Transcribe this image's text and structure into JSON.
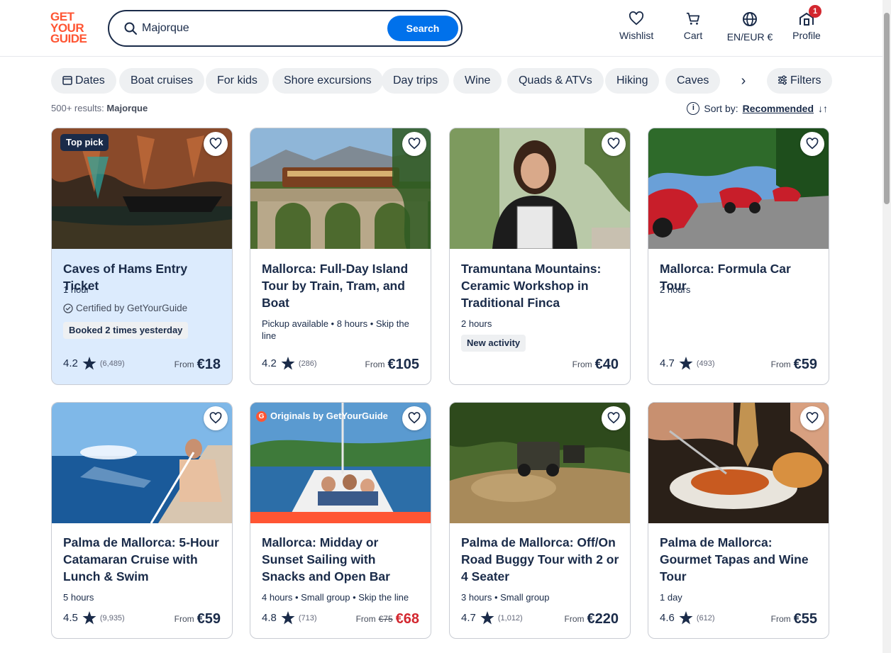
{
  "logo": [
    "GET",
    "YOUR",
    "GUIDE"
  ],
  "search": {
    "value": "Majorque",
    "button": "Search"
  },
  "nav": [
    {
      "label": "Wishlist",
      "icon": "heart-icon"
    },
    {
      "label": "Cart",
      "icon": "cart-icon"
    },
    {
      "label": "EN/EUR €",
      "icon": "globe-icon"
    },
    {
      "label": "Profile",
      "icon": "profile-icon",
      "badge": "1"
    }
  ],
  "chips": [
    "Dates",
    "Boat cruises",
    "For kids",
    "Shore excursions",
    "Day trips",
    "Wine",
    "Quads & ATVs",
    "Hiking",
    "Caves"
  ],
  "filters_label": "Filters",
  "results": {
    "count": "500+ results:",
    "query": "Majorque"
  },
  "sort": {
    "label": "Sort by:",
    "value": "Recommended"
  },
  "colors": {
    "brand": "#ff5533",
    "accent": "#0071eb",
    "sale": "#d3272f",
    "text": "#1a2b49"
  },
  "cards": [
    {
      "title": "Caves of Hams Entry Ticket",
      "meta": "1 hour",
      "certified": "Certified by GetYourGuide",
      "pill": "Booked 2 times yesterday",
      "tag": "Top pick",
      "rating": "4.2",
      "reviews": "(6,489)",
      "from": "From",
      "price": "€18"
    },
    {
      "title": "Mallorca: Full-Day Island Tour by Train, Tram, and Boat",
      "meta": "Pickup available • 8 hours • Skip the line",
      "rating": "4.2",
      "reviews": "(286)",
      "from": "From",
      "price": "€105"
    },
    {
      "title": "Tramuntana Mountains: Ceramic Workshop in Traditional Finca",
      "meta": "2 hours",
      "pill": "New activity",
      "from": "From",
      "price": "€40"
    },
    {
      "title": "Mallorca: Formula Car Tour",
      "meta": "2 hours",
      "rating": "4.7",
      "reviews": "(493)",
      "from": "From",
      "price": "€59"
    },
    {
      "title": "Palma de Mallorca: 5-Hour Catamaran Cruise with Lunch & Swim",
      "meta": "5 hours",
      "rating": "4.5",
      "reviews": "(9,935)",
      "from": "From",
      "price": "€59"
    },
    {
      "title": "Mallorca: Midday or Sunset Sailing with Snacks and Open Bar",
      "meta": "4 hours • Small group • Skip the line",
      "tag": "Originals by GetYourGuide",
      "rating": "4.8",
      "reviews": "(713)",
      "from": "From",
      "old_price": "€75",
      "price": "€68"
    },
    {
      "title": "Palma de Mallorca: Off/On Road Buggy Tour with 2 or 4 Seater",
      "meta": "3 hours • Small group",
      "rating": "4.7",
      "reviews": "(1,012)",
      "from": "From",
      "price": "€220"
    },
    {
      "title": "Palma de Mallorca: Gourmet Tapas and Wine Tour",
      "meta": "1 day",
      "rating": "4.6",
      "reviews": "(612)",
      "from": "From",
      "price": "€55"
    }
  ]
}
